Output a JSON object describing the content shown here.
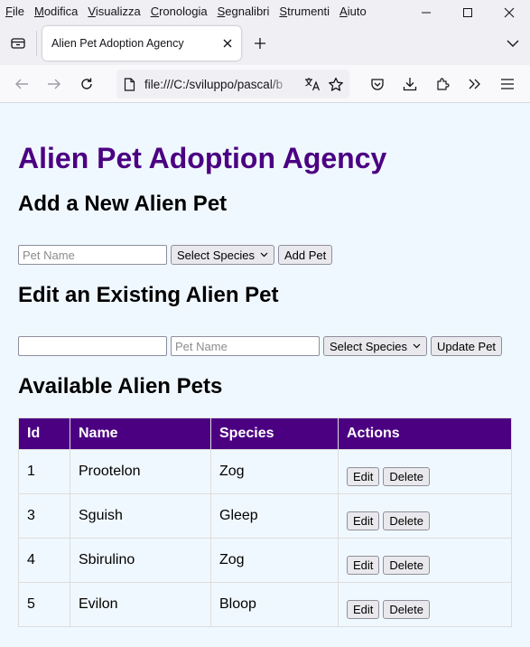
{
  "browser": {
    "menu": [
      "File",
      "Modifica",
      "Visualizza",
      "Cronologia",
      "Segnalibri",
      "Strumenti",
      "Aiuto"
    ],
    "tab_title": "Alien Pet Adoption Agency",
    "url": "file:///C:/sviluppo/pascal/b"
  },
  "page": {
    "title": "Alien Pet Adoption Agency",
    "add_section": {
      "heading": "Add a New Alien Pet",
      "name_placeholder": "Pet Name",
      "species_select": "Select Species",
      "add_button": "Add Pet"
    },
    "edit_section": {
      "heading": "Edit an Existing Alien Pet",
      "id_value": "",
      "name_placeholder": "Pet Name",
      "species_select": "Select Species",
      "update_button": "Update Pet"
    },
    "list_section": {
      "heading": "Available Alien Pets",
      "columns": [
        "Id",
        "Name",
        "Species",
        "Actions"
      ],
      "rows": [
        {
          "id": "1",
          "name": "Prootelon",
          "species": "Zog"
        },
        {
          "id": "3",
          "name": "Sguish",
          "species": "Gleep"
        },
        {
          "id": "4",
          "name": "Sbirulino",
          "species": "Zog"
        },
        {
          "id": "5",
          "name": "Evilon",
          "species": "Bloop"
        }
      ],
      "edit_label": "Edit",
      "delete_label": "Delete"
    }
  },
  "colors": {
    "accent": "#4b0082",
    "page_background": "#f0f8ff"
  }
}
